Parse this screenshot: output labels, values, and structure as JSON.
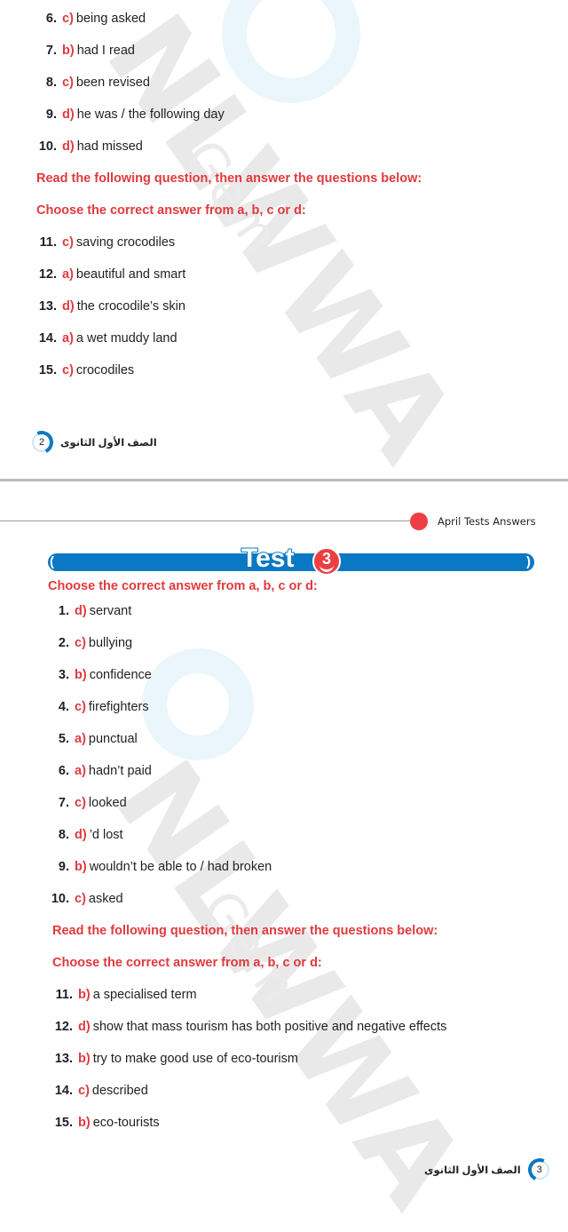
{
  "watermark": {
    "brand": "NLWWA",
    "sub": "Gem"
  },
  "page2": {
    "items": [
      {
        "num": "6.",
        "opt": "c)",
        "text": "being asked"
      },
      {
        "num": "7.",
        "opt": "b)",
        "text": "had I read"
      },
      {
        "num": "8.",
        "opt": "c)",
        "text": "been revised"
      },
      {
        "num": "9.",
        "opt": "d)",
        "text": "he was / the following day"
      },
      {
        "num": "10.",
        "opt": "d)",
        "text": "had missed"
      }
    ],
    "heading_read": "Read the following question, then answer the questions below:",
    "heading_choose": "Choose the correct answer from a, b, c or d:",
    "items2": [
      {
        "num": "11.",
        "opt": "c)",
        "text": "saving crocodiles"
      },
      {
        "num": "12.",
        "opt": "a)",
        "text": "beautiful and smart"
      },
      {
        "num": "13.",
        "opt": "d)",
        "text": "the crocodile’s skin"
      },
      {
        "num": "14.",
        "opt": "a)",
        "text": "a wet muddy land"
      },
      {
        "num": "15.",
        "opt": "c)",
        "text": "crocodiles"
      }
    ],
    "footer": {
      "page_number": "2",
      "grade_label": "الصف الأول الثانوى"
    }
  },
  "page3": {
    "header_title": "April Tests Answers",
    "test_label": "Test",
    "test_number": "3",
    "heading_choose": "Choose the correct answer from a, b, c or d:",
    "items": [
      {
        "num": "1.",
        "opt": "d)",
        "text": "servant"
      },
      {
        "num": "2.",
        "opt": "c)",
        "text": "bullying"
      },
      {
        "num": "3.",
        "opt": "b)",
        "text": "confidence"
      },
      {
        "num": "4.",
        "opt": "c)",
        "text": "firefighters"
      },
      {
        "num": "5.",
        "opt": "a)",
        "text": "punctual"
      },
      {
        "num": "6.",
        "opt": "a)",
        "text": "hadn’t paid"
      },
      {
        "num": "7.",
        "opt": "c)",
        "text": "looked"
      },
      {
        "num": "8.",
        "opt": "d)",
        "text": "’d lost"
      },
      {
        "num": "9.",
        "opt": "b)",
        "text": "wouldn’t be able to / had broken"
      },
      {
        "num": "10.",
        "opt": "c)",
        "text": "asked"
      }
    ],
    "heading_read": "Read the following question, then answer the questions below:",
    "heading_choose2": "Choose the correct answer from a, b, c or d:",
    "items2": [
      {
        "num": "11.",
        "opt": "b)",
        "text": "a specialised term"
      },
      {
        "num": "12.",
        "opt": "d)",
        "text": "show that mass tourism has both positive and negative effects"
      },
      {
        "num": "13.",
        "opt": "b)",
        "text": "try to make good use of eco-tourism"
      },
      {
        "num": "14.",
        "opt": "c)",
        "text": "described"
      },
      {
        "num": "15.",
        "opt": "b)",
        "text": "eco-tourists"
      }
    ],
    "footer": {
      "page_number": "3",
      "grade_label": "الصف الأول الثانوى"
    }
  },
  "colors": {
    "accent_red": "#e03a3e",
    "brand_blue": "#0a78c2"
  }
}
